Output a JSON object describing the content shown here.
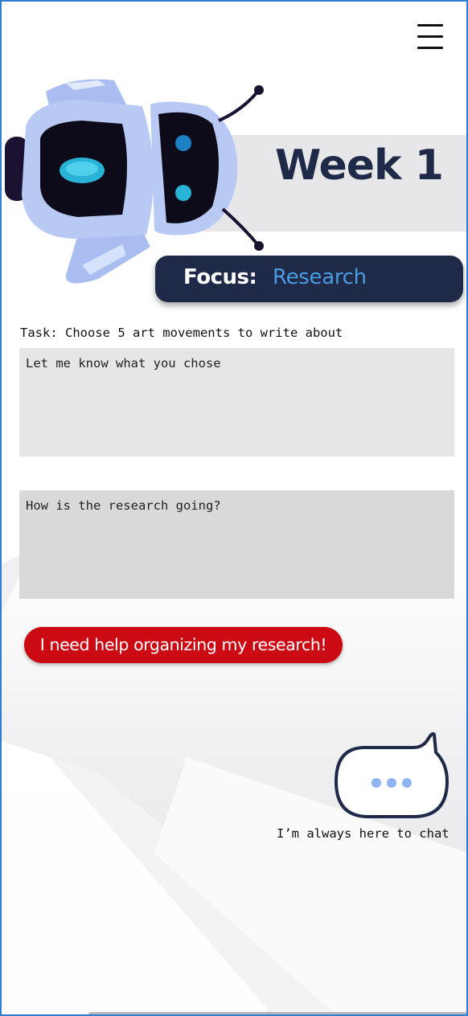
{
  "header": {
    "menu_icon": "hamburger-menu-icon",
    "week_title": "Week 1",
    "mascot_icon": "robot-mascot"
  },
  "focus": {
    "label": "Focus:",
    "value": "Research"
  },
  "task": {
    "text": "Task: Choose 5 art movements to write about",
    "response_placeholder": "Let me know what you chose"
  },
  "progress": {
    "placeholder": "How is the research going?"
  },
  "help_button": {
    "label": "I need help organizing my research!"
  },
  "chat": {
    "icon": "chat-bubble-icon",
    "caption": "I’m always here to chat"
  },
  "colors": {
    "navy": "#1e2a48",
    "accent_blue": "#4a9be0",
    "help_red": "#cc0a14",
    "chat_dots": "#8fb4f2"
  }
}
